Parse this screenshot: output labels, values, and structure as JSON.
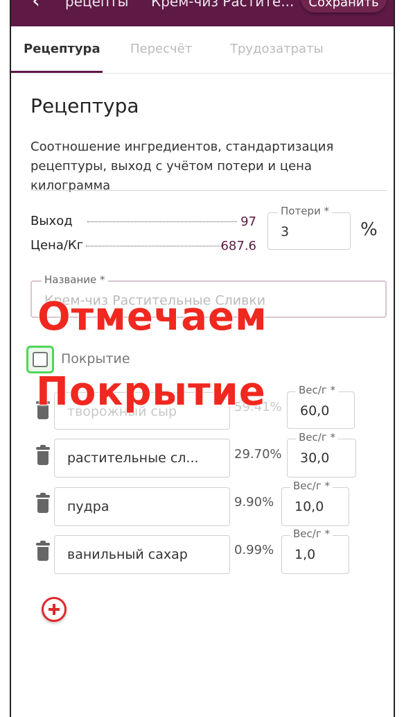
{
  "appbar": {
    "back_icon": "arrow-back-icon",
    "crumb": "рецепты",
    "title": "Крем-чиз Растите...",
    "save_label": "Сохранить",
    "color": "#5e1a45"
  },
  "tabs": [
    {
      "label": "Рецептура",
      "active": true
    },
    {
      "label": "Пересчёт",
      "active": false
    },
    {
      "label": "Трудозатраты",
      "active": false
    }
  ],
  "section": {
    "title": "Рецептура",
    "description": "Соотношение ингредиентов, стандартизация рецептуры, выход с учётом потери и цена килограмма"
  },
  "summary": {
    "yield_label": "Выход",
    "yield_value": "97",
    "price_label": "Цена/Кг",
    "price_value": "687.6"
  },
  "losses": {
    "label": "Потери *",
    "value": "3",
    "unit": "%"
  },
  "name_field": {
    "label": "Название *",
    "value": "Крем-чиз Растительные Сливки"
  },
  "coating": {
    "label": "Покрытие",
    "checked": false
  },
  "ingredients": [
    {
      "name": "творожный сыр",
      "percent": "59.41%",
      "weight_label": "Вес/г *",
      "weight": "60,0"
    },
    {
      "name": "растительные сл...",
      "percent": "29.70%",
      "weight_label": "Вес/г *",
      "weight": "30,0"
    },
    {
      "name": "пудра",
      "percent": "9.90%",
      "weight_label": "Вес/г *",
      "weight": "10,0"
    },
    {
      "name": "ванильный сахар",
      "percent": "0.99%",
      "weight_label": "Вес/г *",
      "weight": "1,0"
    }
  ],
  "overlay": {
    "line1": "Отмечаем",
    "line2": "Покрытие",
    "color": "#f0281f"
  },
  "add_icon": "plus-circle-icon"
}
